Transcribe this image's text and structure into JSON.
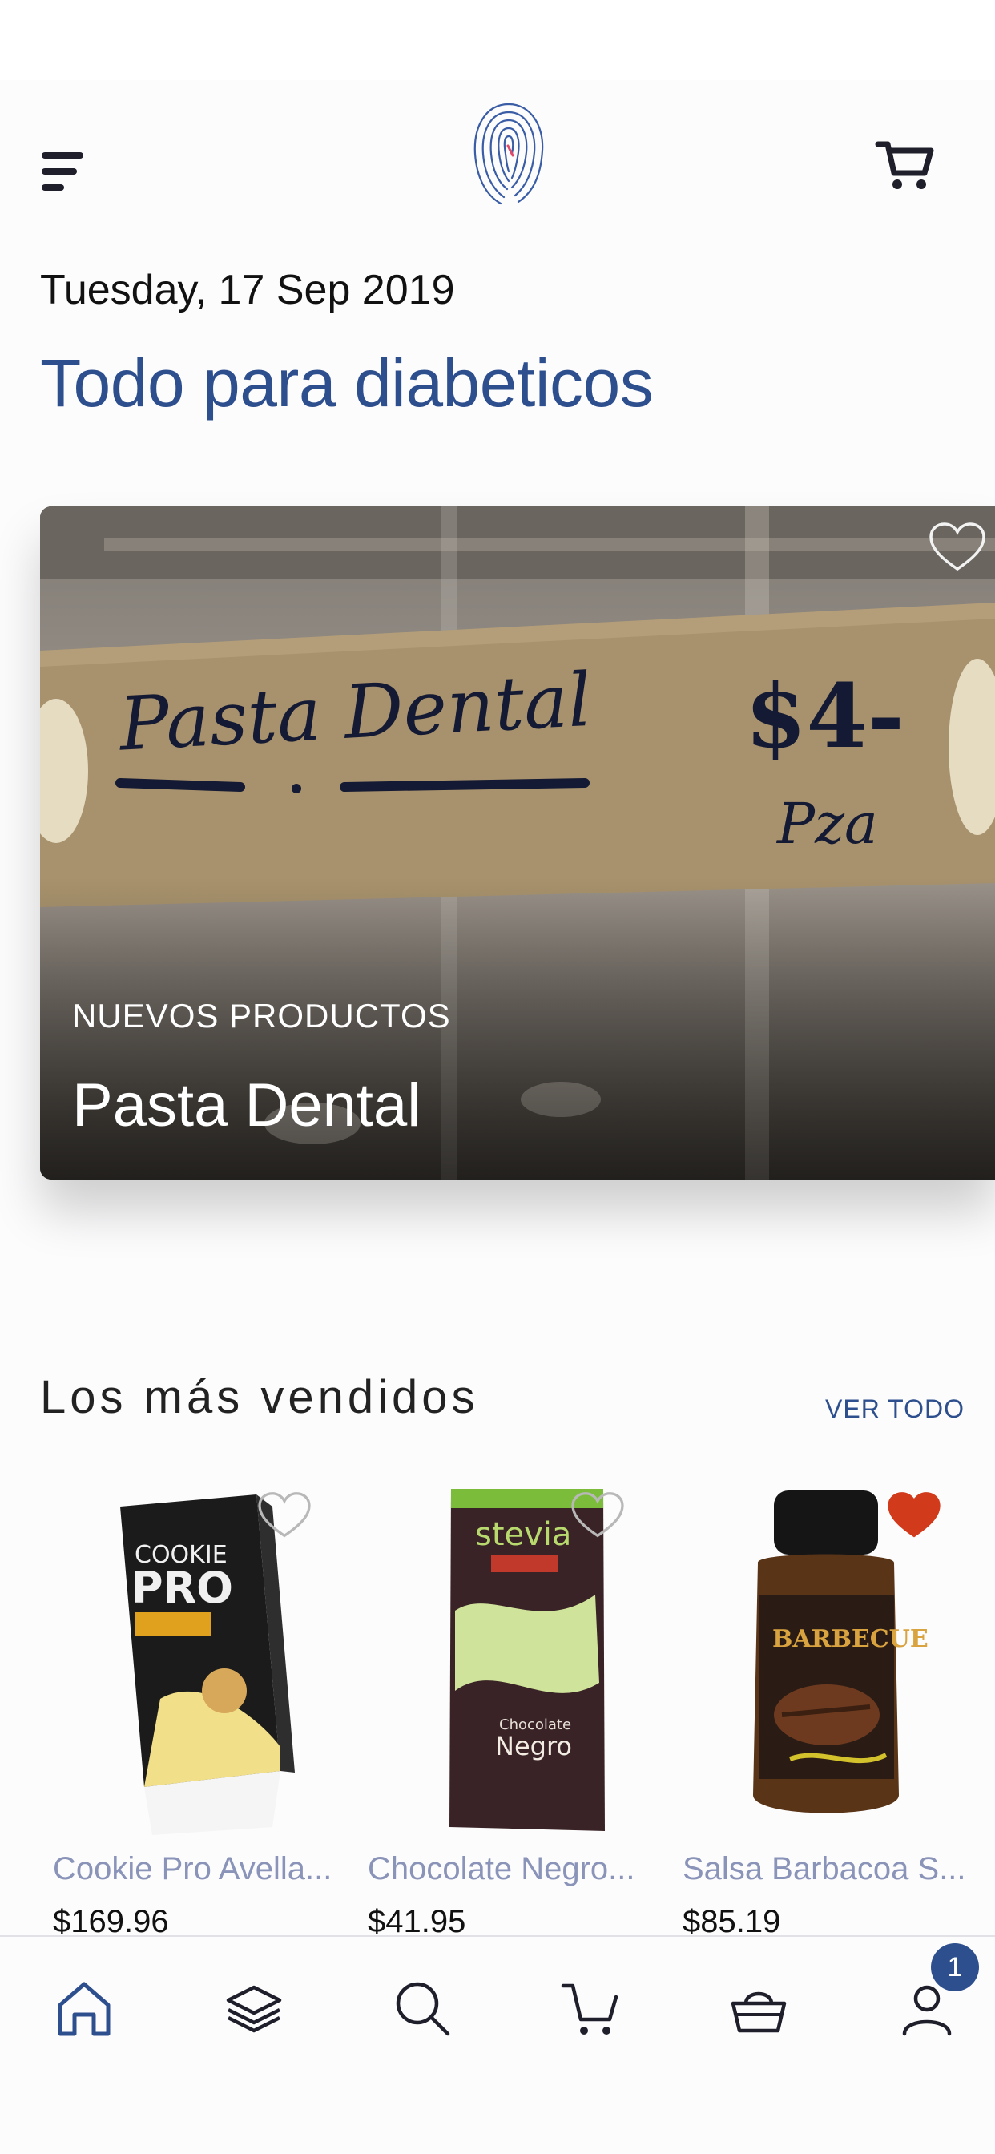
{
  "header": {
    "menu_icon": "hamburger-menu-icon",
    "logo_icon": "fingerprint-logo-icon",
    "cart_icon": "cart-icon"
  },
  "date": "Tuesday, 17 Sep 2019",
  "headline": "Todo para diabeticos",
  "hero": {
    "kicker": "NUEVOS PRODUCTOS",
    "title": "Pasta Dental",
    "favorite": false,
    "sign_text": "Pasta Dental $4- Pza"
  },
  "best_sellers": {
    "title": "Los más vendidos",
    "see_all": "VER TODO",
    "products": [
      {
        "name": "Cookie Pro Avella...",
        "price": "$169.96",
        "favorite": false,
        "package_text": "COOKIE PRO"
      },
      {
        "name": "Chocolate Negro...",
        "price": "$41.95",
        "favorite": false,
        "package_text": "stevia Chocolate Negro"
      },
      {
        "name": "Salsa Barbacoa S...",
        "price": "$85.19",
        "favorite": true,
        "package_text": "BARBECUE"
      }
    ]
  },
  "tabbar": {
    "items": [
      {
        "icon": "home-icon",
        "active": true
      },
      {
        "icon": "layers-icon",
        "active": false
      },
      {
        "icon": "search-icon",
        "active": false
      },
      {
        "icon": "cart-icon",
        "active": false
      },
      {
        "icon": "basket-icon",
        "active": false
      },
      {
        "icon": "profile-icon",
        "active": false
      }
    ],
    "profile_badge": "1"
  },
  "colors": {
    "accent": "#2e4f8e",
    "favorite_active": "#d13a1a",
    "product_name": "#8a93b8"
  }
}
